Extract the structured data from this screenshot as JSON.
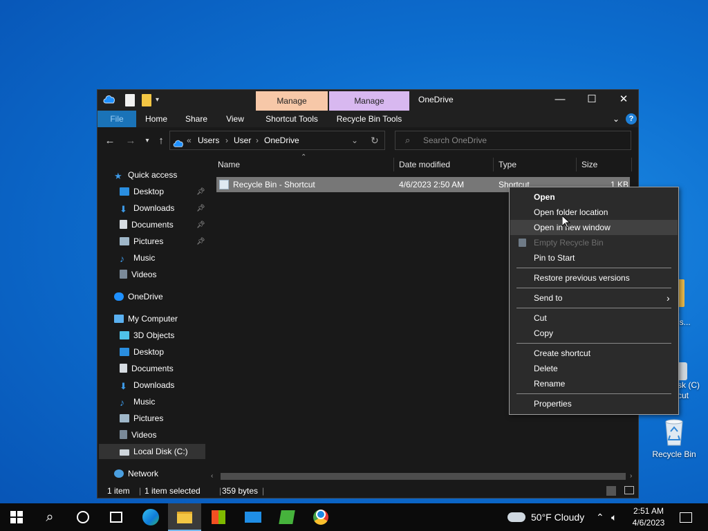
{
  "desktop": {
    "icons": [
      {
        "label": "Recycle Bin",
        "icon": "recycle-bin-icon"
      },
      {
        "label_lines": [
          "v",
          "ress..."
        ],
        "icon": "folder-icon"
      },
      {
        "label_lines": [
          "sk (C)",
          "cut"
        ],
        "icon": "drive-shortcut-icon"
      }
    ]
  },
  "window": {
    "title": "OneDrive",
    "contextual_tabs": {
      "shortcut_manage": "Manage",
      "recycle_manage": "Manage"
    },
    "ribbon_tabs": [
      "File",
      "Home",
      "Share",
      "View",
      "Shortcut Tools",
      "Recycle Bin Tools"
    ],
    "address": {
      "prefix": "«",
      "crumbs": [
        "Users",
        "User",
        "OneDrive"
      ]
    },
    "search_placeholder": "Search OneDrive",
    "colors": {
      "file_tab_bg": "#1a73b8",
      "manage_shortcut": "#f7c8a8",
      "manage_recycle": "#d8b8f0",
      "selection": "#777777"
    }
  },
  "sidebar": {
    "quick_access": "Quick access",
    "quick_items": [
      "Desktop",
      "Downloads",
      "Documents",
      "Pictures",
      "Music",
      "Videos"
    ],
    "onedrive": "OneDrive",
    "my_computer": "My Computer",
    "pc_items": [
      "3D Objects",
      "Desktop",
      "Documents",
      "Downloads",
      "Music",
      "Pictures",
      "Videos",
      "Local Disk (C:)"
    ],
    "network": "Network"
  },
  "columns": {
    "name": "Name",
    "date": "Date modified",
    "type": "Type",
    "size": "Size"
  },
  "files": [
    {
      "name": "Recycle Bin - Shortcut",
      "date": "4/6/2023 2:50 AM",
      "type": "Shortcut",
      "size": "1 KB"
    }
  ],
  "status": {
    "count": "1 item",
    "selected": "1 item selected",
    "bytes": "359 bytes"
  },
  "context_menu": {
    "items": [
      "Open",
      "Open folder location",
      "Open in new window",
      "Empty Recycle Bin",
      "Pin to Start",
      "Restore previous versions",
      "Send to",
      "Cut",
      "Copy",
      "Create shortcut",
      "Delete",
      "Rename",
      "Properties"
    ]
  },
  "taskbar": {
    "weather": "50°F  Cloudy",
    "time": "2:51 AM",
    "date": "4/6/2023"
  }
}
